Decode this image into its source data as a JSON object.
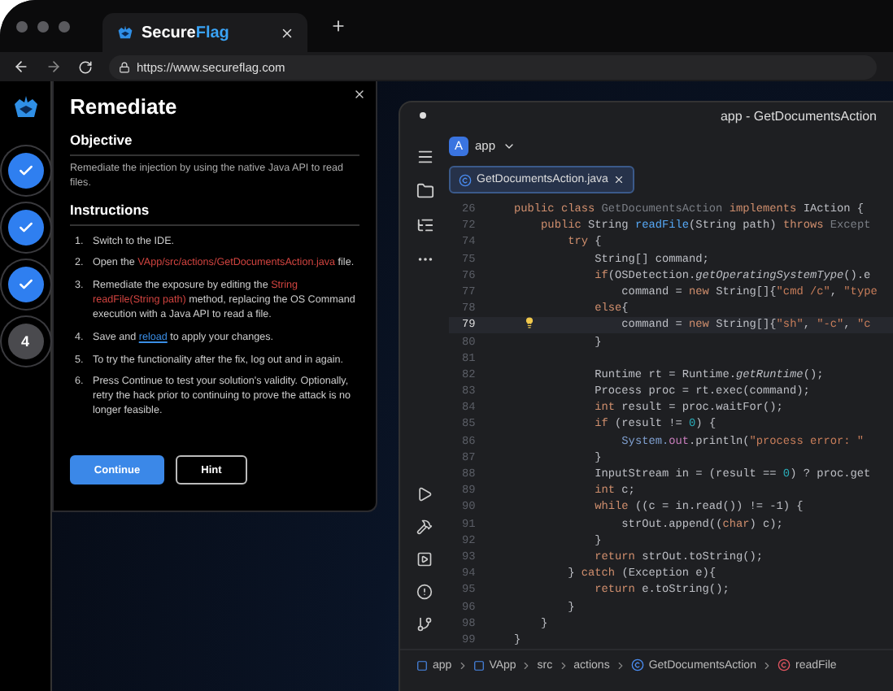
{
  "browser": {
    "tab": {
      "logo_text": "Secure",
      "logo_accent": "Flag"
    },
    "url": "https://www.secureflag.com"
  },
  "steps": [
    {
      "done": true
    },
    {
      "done": true
    },
    {
      "done": true
    },
    {
      "done": false,
      "number": "4"
    }
  ],
  "panel": {
    "title": "Remediate",
    "objective_heading": "Objective",
    "objective": "Remediate the injection by using the native Java API to read files.",
    "instructions_heading": "Instructions",
    "instructions": [
      {
        "number": "1.",
        "parts": [
          {
            "text": "Switch to the IDE.",
            "kind": "text"
          }
        ]
      },
      {
        "number": "2.",
        "parts": [
          {
            "text": "Open the ",
            "kind": "text"
          },
          {
            "text": "VApp/src/actions/GetDocumentsAction.java",
            "kind": "code"
          },
          {
            "text": " file.",
            "kind": "text"
          }
        ]
      },
      {
        "number": "3.",
        "parts": [
          {
            "text": "Remediate the exposure by editing the ",
            "kind": "text"
          },
          {
            "text": "String readFile(String path)",
            "kind": "code"
          },
          {
            "text": " method, replacing the OS Command execution with a Java API to read a file.",
            "kind": "text"
          }
        ]
      },
      {
        "number": "4.",
        "parts": [
          {
            "text": "Save and ",
            "kind": "text"
          },
          {
            "text": "reload",
            "kind": "link"
          },
          {
            "text": " to apply your changes.",
            "kind": "text"
          }
        ]
      },
      {
        "number": "5.",
        "parts": [
          {
            "text": "To try the functionality after the fix, log out and in again.",
            "kind": "text"
          }
        ]
      },
      {
        "number": "6.",
        "parts": [
          {
            "text": "Press Continue to test your solution's validity. Optionally, retry the hack prior to continuing to prove the attack is no longer feasible.",
            "kind": "text"
          }
        ]
      }
    ],
    "buttons": [
      {
        "label": "Continue",
        "kind": "primary"
      },
      {
        "label": "Hint",
        "kind": "outline"
      }
    ]
  },
  "ide": {
    "title": "app - GetDocumentsAction",
    "project_badge": "A",
    "project": "app",
    "file_tab": "GetDocumentsAction.java",
    "lines": [
      {
        "number": "26",
        "current": false,
        "tokens": [
          {
            "text": "public class ",
            "kind": "kw"
          },
          {
            "text": "GetDocumentsAction ",
            "kind": "dim"
          },
          {
            "text": "implements ",
            "kind": "kw"
          },
          {
            "text": "IAction {",
            "kind": "plain"
          }
        ]
      },
      {
        "number": "72",
        "current": false,
        "tokens": [
          {
            "text": "    public ",
            "kind": "kw"
          },
          {
            "text": "String ",
            "kind": "plain"
          },
          {
            "text": "readFile",
            "kind": "fn"
          },
          {
            "text": "(String path) ",
            "kind": "plain"
          },
          {
            "text": "throws ",
            "kind": "kw"
          },
          {
            "text": "Except",
            "kind": "dim"
          }
        ]
      },
      {
        "number": "74",
        "current": false,
        "tokens": [
          {
            "text": "        try ",
            "kind": "kw"
          },
          {
            "text": "{",
            "kind": "plain"
          }
        ]
      },
      {
        "number": "75",
        "current": false,
        "tokens": [
          {
            "text": "            String[] command;",
            "kind": "plain"
          }
        ]
      },
      {
        "number": "76",
        "current": false,
        "tokens": [
          {
            "text": "            if",
            "kind": "kw"
          },
          {
            "text": "(OSDetection.",
            "kind": "plain"
          },
          {
            "text": "getOperatingSystemType",
            "kind": "italic"
          },
          {
            "text": "().e",
            "kind": "plain"
          }
        ]
      },
      {
        "number": "77",
        "current": false,
        "tokens": [
          {
            "text": "                command = ",
            "kind": "plain"
          },
          {
            "text": "new ",
            "kind": "kw"
          },
          {
            "text": "String[]{",
            "kind": "plain"
          },
          {
            "text": "\"cmd /c\"",
            "kind": "str"
          },
          {
            "text": ", ",
            "kind": "plain"
          },
          {
            "text": "\"type",
            "kind": "str"
          }
        ]
      },
      {
        "number": "78",
        "current": false,
        "tokens": [
          {
            "text": "            else",
            "kind": "kw"
          },
          {
            "text": "{",
            "kind": "plain"
          }
        ]
      },
      {
        "number": "79",
        "current": true,
        "tokens": [
          {
            "text": "                command = ",
            "kind": "plain"
          },
          {
            "text": "new ",
            "kind": "kw"
          },
          {
            "text": "String[]{",
            "kind": "plain"
          },
          {
            "text": "\"sh\"",
            "kind": "str"
          },
          {
            "text": ", ",
            "kind": "plain"
          },
          {
            "text": "\"-c\"",
            "kind": "str"
          },
          {
            "text": ", ",
            "kind": "plain"
          },
          {
            "text": "\"c",
            "kind": "str"
          }
        ]
      },
      {
        "number": "80",
        "current": false,
        "tokens": [
          {
            "text": "            }",
            "kind": "plain"
          }
        ]
      },
      {
        "number": "81",
        "current": false
      },
      {
        "number": "82",
        "current": false,
        "tokens": [
          {
            "text": "            Runtime rt = Runtime.",
            "kind": "plain"
          },
          {
            "text": "getRuntime",
            "kind": "italic"
          },
          {
            "text": "();",
            "kind": "plain"
          }
        ]
      },
      {
        "number": "83",
        "current": false,
        "tokens": [
          {
            "text": "            Process proc = rt.exec(command);",
            "kind": "plain"
          }
        ]
      },
      {
        "number": "84",
        "current": false,
        "tokens": [
          {
            "text": "            int ",
            "kind": "kw"
          },
          {
            "text": "result = proc.waitFor();",
            "kind": "plain"
          }
        ]
      },
      {
        "number": "85",
        "current": false,
        "tokens": [
          {
            "text": "            if ",
            "kind": "kw"
          },
          {
            "text": "(result != ",
            "kind": "plain"
          },
          {
            "text": "0",
            "kind": "num"
          },
          {
            "text": ") {",
            "kind": "plain"
          }
        ]
      },
      {
        "number": "86",
        "current": false,
        "tokens": [
          {
            "text": "                System.",
            "kind": "type"
          },
          {
            "text": "out",
            "kind": "field"
          },
          {
            "text": ".println(",
            "kind": "plain"
          },
          {
            "text": "\"process error: \"",
            "kind": "str"
          }
        ]
      },
      {
        "number": "87",
        "current": false,
        "tokens": [
          {
            "text": "            }",
            "kind": "plain"
          }
        ]
      },
      {
        "number": "88",
        "current": false,
        "tokens": [
          {
            "text": "            InputStream in = (result == ",
            "kind": "plain"
          },
          {
            "text": "0",
            "kind": "num"
          },
          {
            "text": ") ? proc.get",
            "kind": "plain"
          }
        ]
      },
      {
        "number": "89",
        "current": false,
        "tokens": [
          {
            "text": "            int ",
            "kind": "kw"
          },
          {
            "text": "c;",
            "kind": "plain"
          }
        ]
      },
      {
        "number": "90",
        "current": false,
        "tokens": [
          {
            "text": "            while ",
            "kind": "kw"
          },
          {
            "text": "((c = in.read()) != -1) {",
            "kind": "plain"
          }
        ]
      },
      {
        "number": "91",
        "current": false,
        "tokens": [
          {
            "text": "                strOut.append((",
            "kind": "plain"
          },
          {
            "text": "char",
            "kind": "kw"
          },
          {
            "text": ") c);",
            "kind": "plain"
          }
        ]
      },
      {
        "number": "92",
        "current": false,
        "tokens": [
          {
            "text": "            }",
            "kind": "plain"
          }
        ]
      },
      {
        "number": "93",
        "current": false,
        "tokens": [
          {
            "text": "            return ",
            "kind": "kw"
          },
          {
            "text": "strOut.toString();",
            "kind": "plain"
          }
        ]
      },
      {
        "number": "94",
        "current": false,
        "tokens": [
          {
            "text": "        } ",
            "kind": "plain"
          },
          {
            "text": "catch ",
            "kind": "kw"
          },
          {
            "text": "(Exception e){",
            "kind": "plain"
          }
        ]
      },
      {
        "number": "95",
        "current": false,
        "tokens": [
          {
            "text": "            return ",
            "kind": "kw"
          },
          {
            "text": "e.toString();",
            "kind": "plain"
          }
        ]
      },
      {
        "number": "96",
        "current": false,
        "tokens": [
          {
            "text": "        }",
            "kind": "plain"
          }
        ]
      },
      {
        "number": "98",
        "current": false,
        "tokens": [
          {
            "text": "    }",
            "kind": "plain"
          }
        ]
      },
      {
        "number": "99",
        "current": false,
        "tokens": [
          {
            "text": "}",
            "kind": "plain"
          }
        ]
      }
    ],
    "breadcrumb": [
      {
        "label": "app",
        "kind": "module"
      },
      {
        "label": "VApp",
        "kind": "module"
      },
      {
        "label": "src",
        "kind": "plain"
      },
      {
        "label": "actions",
        "kind": "plain"
      },
      {
        "label": "GetDocumentsAction",
        "kind": "class"
      },
      {
        "label": "readFile",
        "kind": "method"
      }
    ]
  }
}
